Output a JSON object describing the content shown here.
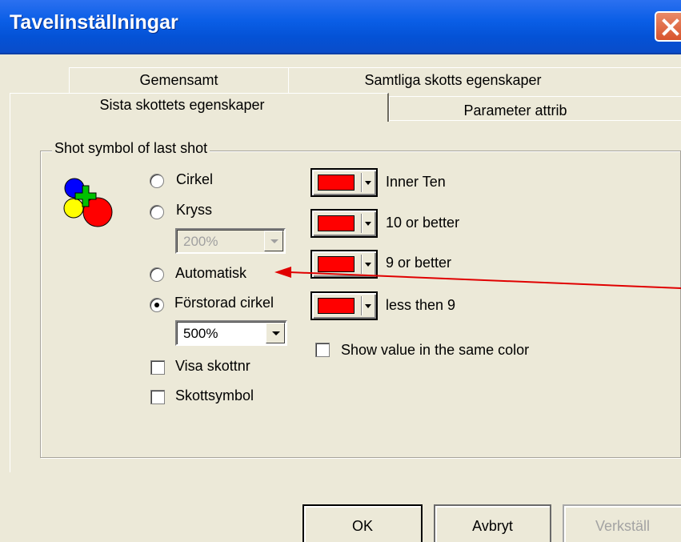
{
  "window": {
    "title": "Tavelinställningar"
  },
  "tabs": {
    "back_row": [
      "Gemensamt",
      "Samtliga skotts egenskaper"
    ],
    "front_row": [
      "Sista skottets egenskaper",
      "Parameter attrib"
    ],
    "active": "Sista skottets egenskaper"
  },
  "group": {
    "legend": "Shot symbol of last shot",
    "radios": [
      {
        "label": "Cirkel",
        "checked": false
      },
      {
        "label": "Kryss",
        "checked": false
      },
      {
        "label": "Automatisk",
        "checked": false
      },
      {
        "label": "Förstorad cirkel",
        "checked": true
      }
    ],
    "kryss_combo": {
      "value": "200%",
      "disabled": true
    },
    "cirkel_combo": {
      "value": "500%",
      "disabled": false
    },
    "checkboxes": [
      {
        "label": "Visa skottnr",
        "checked": false
      },
      {
        "label": "Skottsymbol",
        "checked": false
      }
    ],
    "colors": [
      {
        "label": "Inner Ten",
        "color": "#ff0000"
      },
      {
        "label": "10 or better",
        "color": "#ff0000"
      },
      {
        "label": "9 or better",
        "color": "#ff0000"
      },
      {
        "label": "less then 9",
        "color": "#ff0000"
      }
    ],
    "same_color_checkbox": {
      "label": "Show value in the same color",
      "checked": false
    }
  },
  "buttons": {
    "ok": "OK",
    "cancel": "Avbryt",
    "apply": {
      "label": "Verkställ",
      "disabled": true
    }
  },
  "annotation_color": "#e00000"
}
